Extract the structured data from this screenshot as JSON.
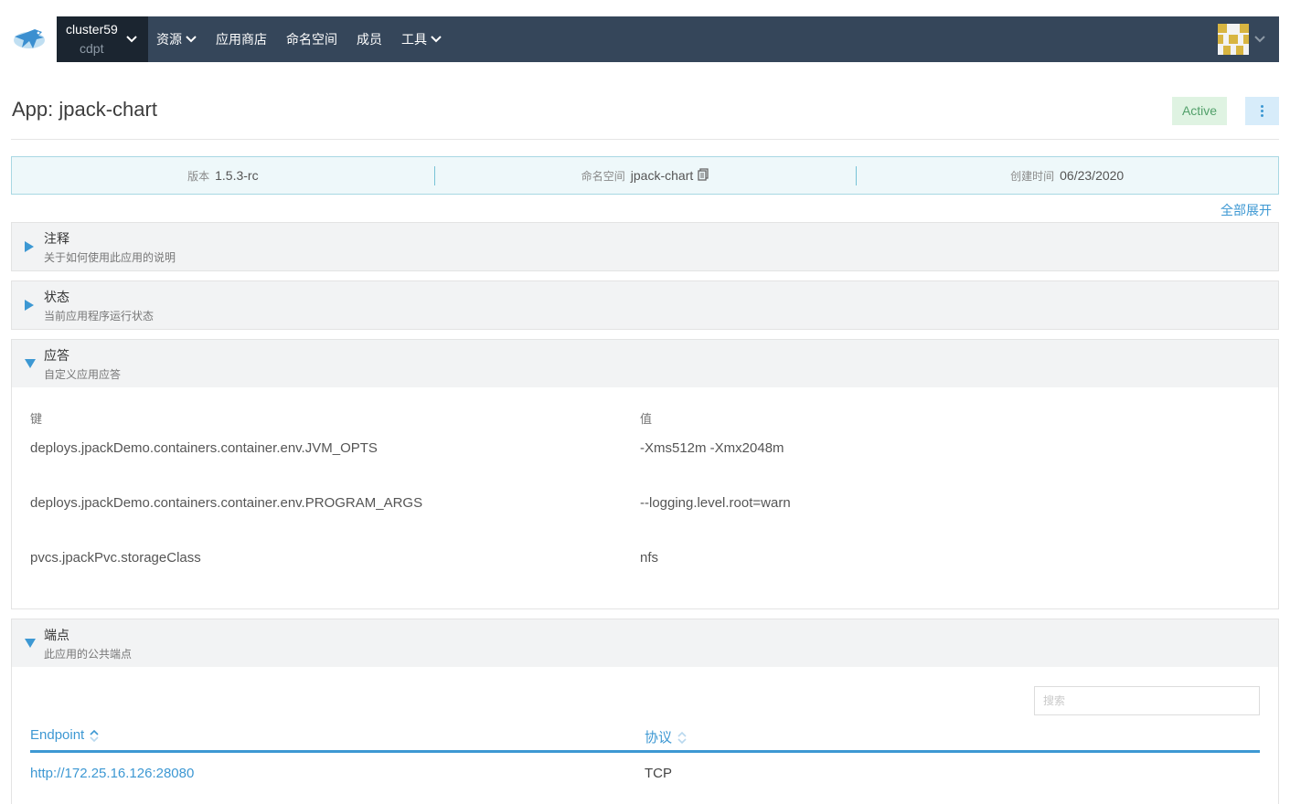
{
  "header": {
    "cluster_name": "cluster59",
    "project_name": "cdpt",
    "nav": [
      {
        "label": "资源",
        "dropdown": true
      },
      {
        "label": "应用商店",
        "dropdown": false
      },
      {
        "label": "命名空间",
        "dropdown": false
      },
      {
        "label": "成员",
        "dropdown": false
      },
      {
        "label": "工具",
        "dropdown": true
      }
    ]
  },
  "page": {
    "title": "App: jpack-chart",
    "status": "Active"
  },
  "info": {
    "version_label": "版本",
    "version_value": "1.5.3-rc",
    "namespace_label": "命名空间",
    "namespace_value": "jpack-chart",
    "created_label": "创建时间",
    "created_value": "06/23/2020"
  },
  "expand_all": "全部展开",
  "sections": {
    "notes": {
      "title": "注释",
      "desc": "关于如何使用此应用的说明"
    },
    "status": {
      "title": "状态",
      "desc": "当前应用程序运行状态"
    },
    "answers": {
      "title": "应答",
      "desc": "自定义应用应答"
    },
    "endpoints": {
      "title": "端点",
      "desc": "此应用的公共端点"
    }
  },
  "answers": {
    "key_header": "键",
    "value_header": "值",
    "rows": [
      {
        "key": "deploys.jpackDemo.containers.container.env.JVM_OPTS",
        "value": "-Xms512m -Xmx2048m"
      },
      {
        "key": "deploys.jpackDemo.containers.container.env.PROGRAM_ARGS",
        "value": "--logging.level.root=warn"
      },
      {
        "key": "pvcs.jpackPvc.storageClass",
        "value": "nfs"
      }
    ]
  },
  "endpoints": {
    "search_placeholder": "搜索",
    "col_endpoint": "Endpoint",
    "col_protocol": "协议",
    "rows": [
      {
        "endpoint": "http://172.25.16.126:28080",
        "protocol": "TCP"
      }
    ]
  },
  "colors": {
    "topbar": "#35465a",
    "cluster_bg": "#1b2530",
    "accent": "#3d98d3",
    "active_bg": "#dff3e2",
    "active_text": "#52a06a"
  }
}
